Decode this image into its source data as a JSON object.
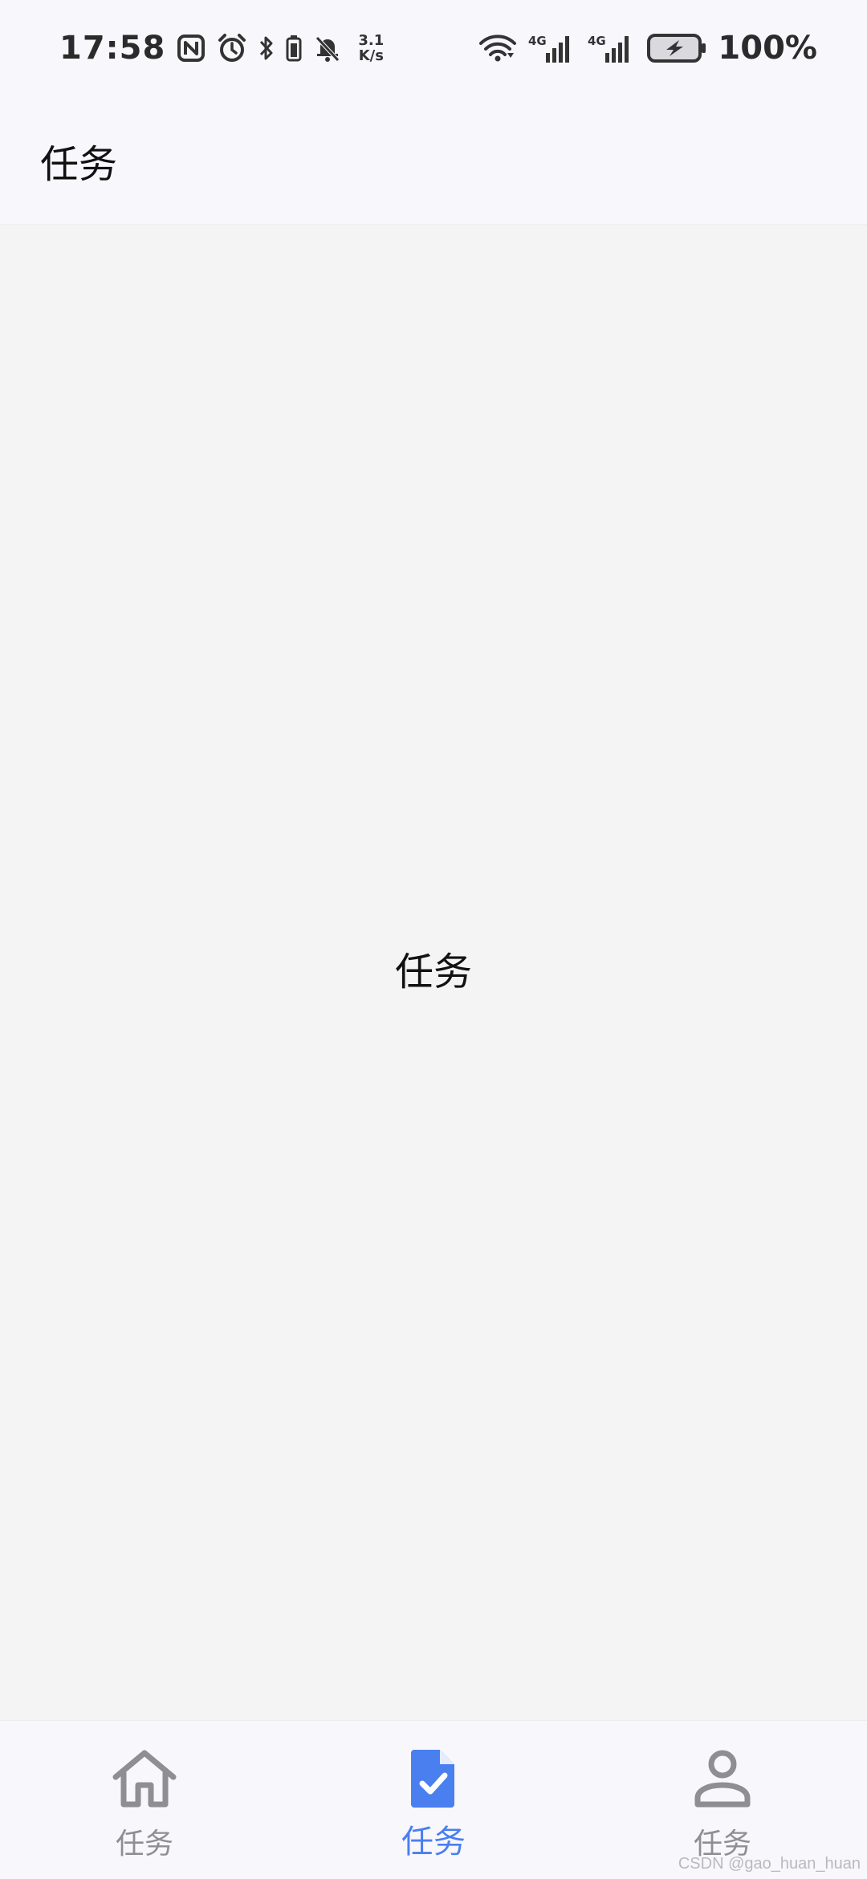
{
  "status_bar": {
    "time": "17:58",
    "speed_value": "3.1",
    "speed_unit": "K/s",
    "network_1": "4G",
    "network_2": "4G",
    "battery_percent": "100%",
    "icons": [
      "nfc-icon",
      "alarm-icon",
      "bluetooth-icon",
      "battery-small-icon",
      "mute-icon",
      "wifi-icon",
      "signal-icon",
      "battery-charging-icon"
    ]
  },
  "app_bar": {
    "title": "任务"
  },
  "content": {
    "center_text": "任务"
  },
  "bottom_nav": {
    "items": [
      {
        "label": "任务",
        "icon": "home-icon",
        "active": false
      },
      {
        "label": "任务",
        "icon": "task-document-icon",
        "active": true
      },
      {
        "label": "任务",
        "icon": "person-icon",
        "active": false
      }
    ],
    "active_color": "#4a7ff0",
    "inactive_color": "#8e8e93"
  },
  "watermark": "CSDN @gao_huan_huan"
}
